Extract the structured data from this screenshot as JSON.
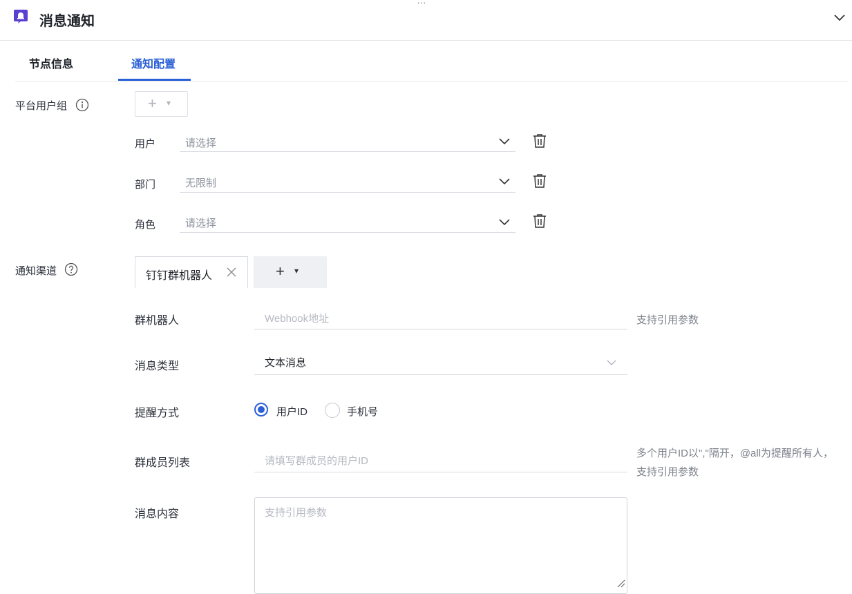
{
  "header": {
    "top_mark": "...",
    "title": "消息通知",
    "icon": "notification-bell-icon",
    "collapse_icon": "chevron-down-icon"
  },
  "tabs": [
    {
      "label": "节点信息",
      "active": false
    },
    {
      "label": "通知配置",
      "active": true
    }
  ],
  "platform_group": {
    "label": "平台用户组",
    "help_icon": "info-icon",
    "add_button": {
      "plus": "+",
      "caret": "▾"
    },
    "rows": [
      {
        "label": "用户",
        "value": "请选择"
      },
      {
        "label": "部门",
        "value": "无限制"
      },
      {
        "label": "角色",
        "value": "请选择"
      }
    ]
  },
  "channels": {
    "label": "通知渠道",
    "help_icon": "question-icon",
    "active_tab": "钉钉群机器人",
    "add_button": {
      "plus": "+",
      "caret": "▾"
    }
  },
  "form": {
    "robot": {
      "label": "群机器人",
      "placeholder": "Webhook地址",
      "hint": "支持引用参数"
    },
    "msg_type": {
      "label": "消息类型",
      "value": "文本消息"
    },
    "remind": {
      "label": "提醒方式",
      "options": [
        {
          "label": "用户ID",
          "selected": true
        },
        {
          "label": "手机号",
          "selected": false
        }
      ]
    },
    "members": {
      "label": "群成员列表",
      "placeholder": "请填写群成员的用户ID",
      "hint_line1": "多个用户ID以\",\"隔开，@all为提醒所有人，",
      "hint_line2": "支持引用参数"
    },
    "content": {
      "label": "消息内容",
      "placeholder": "支持引用参数"
    }
  },
  "colors": {
    "accent": "#2a5fd6",
    "brand_icon": "#5b3fd0"
  }
}
